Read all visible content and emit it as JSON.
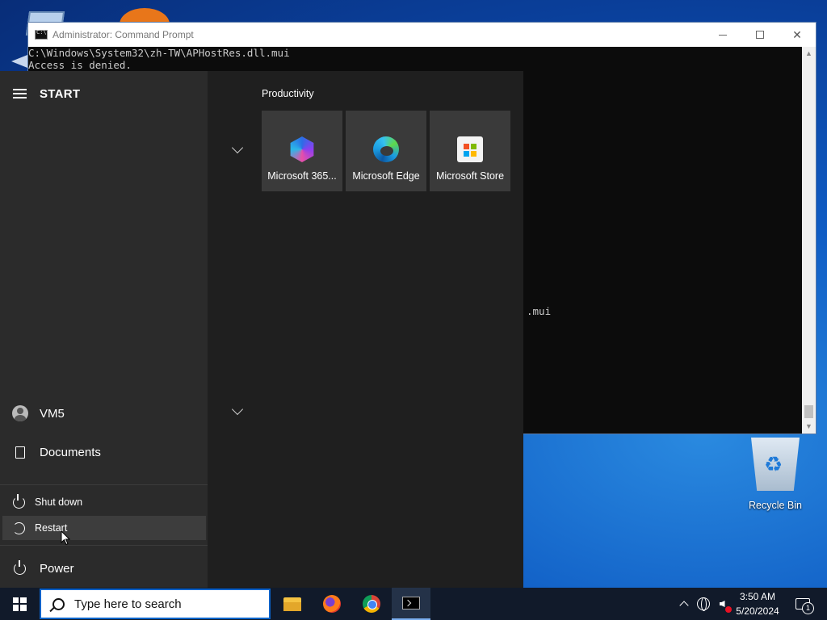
{
  "cmd": {
    "title": "Administrator: Command Prompt",
    "lines": [
      "C:\\Windows\\System32\\zh-TW\\APHostRes.dll.mui",
      "Access is denied."
    ],
    "partial_line": ".mui"
  },
  "start_menu": {
    "title": "START",
    "user": "VM5",
    "documents": "Documents",
    "power": "Power",
    "power_menu": {
      "shutdown": "Shut down",
      "restart": "Restart"
    },
    "group_title": "Productivity",
    "tiles": [
      {
        "label": "Microsoft 365...",
        "icon": "microsoft-365-icon"
      },
      {
        "label": "Microsoft Edge",
        "icon": "edge-icon"
      },
      {
        "label": "Microsoft Store",
        "icon": "store-icon"
      }
    ]
  },
  "desktop": {
    "recycle_bin": "Recycle Bin"
  },
  "taskbar": {
    "search_placeholder": "Type here to search",
    "time": "3:50 AM",
    "date": "5/20/2024",
    "notification_count": "1",
    "apps": [
      "file-explorer-icon",
      "firefox-icon",
      "chrome-icon",
      "command-prompt-icon"
    ]
  }
}
